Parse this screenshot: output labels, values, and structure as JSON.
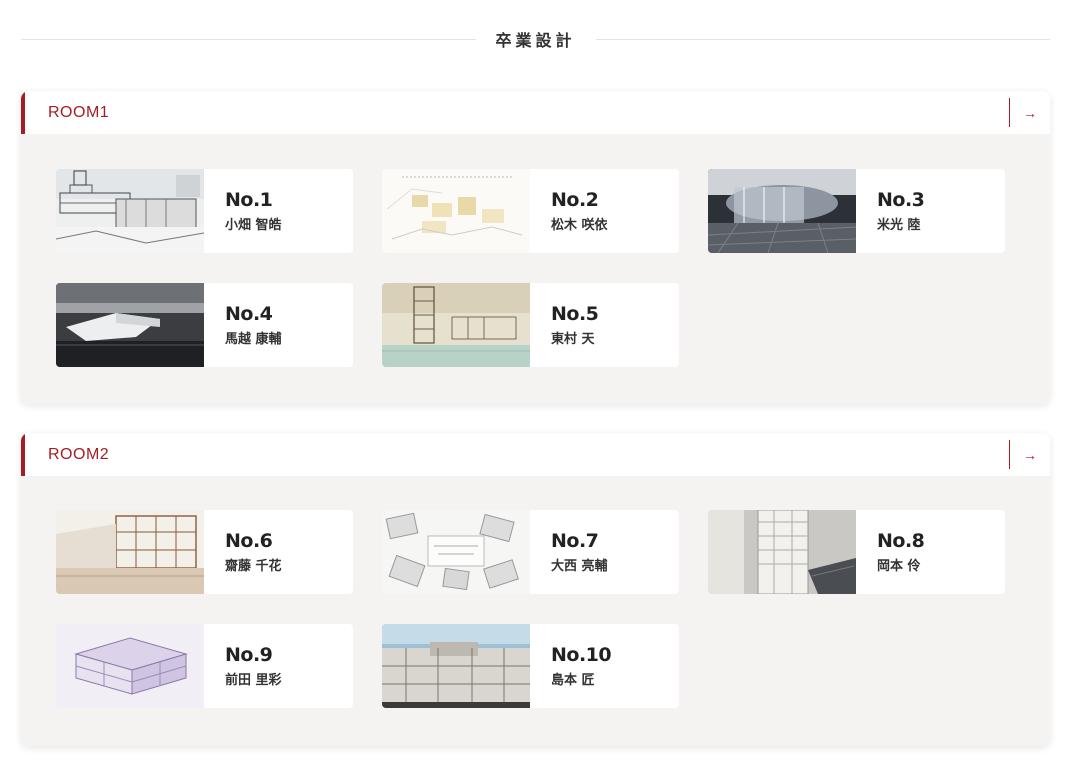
{
  "page": {
    "title": "卒業設計"
  },
  "rooms": [
    {
      "title": "ROOM1",
      "arrow": "→",
      "works": [
        {
          "no": "No.1",
          "name": "小畑 智皓",
          "thumb": "architecture-sketch-thumbnail"
        },
        {
          "no": "No.2",
          "name": "松木 咲依",
          "thumb": "site-plan-thumbnail"
        },
        {
          "no": "No.3",
          "name": "米光 陸",
          "thumb": "interior-render-thumbnail"
        },
        {
          "no": "No.4",
          "name": "馬越 康輔",
          "thumb": "waterfront-render-thumbnail"
        },
        {
          "no": "No.5",
          "name": "東村 天",
          "thumb": "structure-perspective-thumbnail"
        }
      ]
    },
    {
      "title": "ROOM2",
      "arrow": "→",
      "works": [
        {
          "no": "No.6",
          "name": "齋藤 千花",
          "thumb": "timber-structure-thumbnail"
        },
        {
          "no": "No.7",
          "name": "大西 亮輔",
          "thumb": "collage-diagram-thumbnail"
        },
        {
          "no": "No.8",
          "name": "岡本 伶",
          "thumb": "tower-model-thumbnail"
        },
        {
          "no": "No.9",
          "name": "前田 里彩",
          "thumb": "axonometric-thumbnail"
        },
        {
          "no": "No.10",
          "name": "島本 匠",
          "thumb": "section-model-thumbnail"
        }
      ]
    }
  ],
  "colors": {
    "accent": "#a61c24",
    "room_background": "#f4f3f1"
  }
}
